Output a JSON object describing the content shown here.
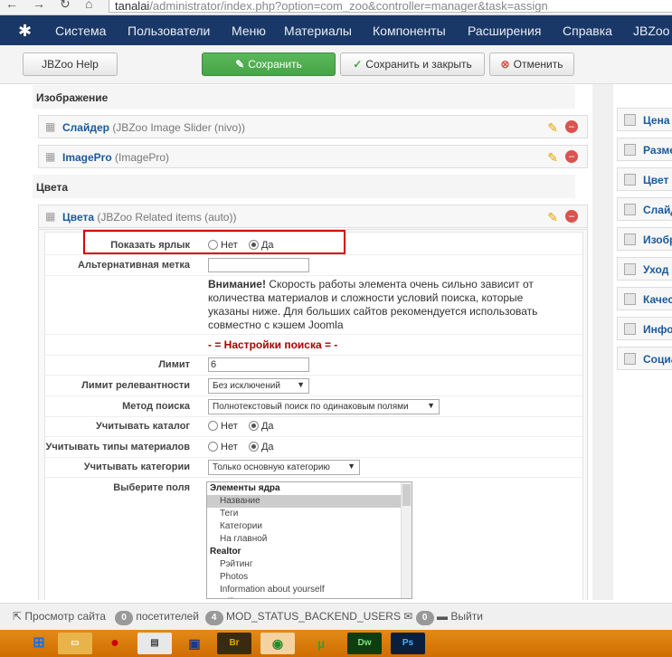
{
  "browser": {
    "url_host": "tanalai",
    "url_path": "/administrator/index.php?option=com_zoo&controller=manager&task=assign"
  },
  "menu": {
    "items": [
      "Система",
      "Пользователи",
      "Меню",
      "Материалы",
      "Компоненты",
      "Расширения",
      "Справка",
      "JBZoo"
    ]
  },
  "toolbar": {
    "help_label": "JBZoo Help",
    "save_label": "Сохранить",
    "save_close_label": "Сохранить и закрыть",
    "cancel_label": "Отменить"
  },
  "sections": {
    "image": "Изображение",
    "colors": "Цвета"
  },
  "elements": [
    {
      "title": "Слайдер",
      "subtitle": "(JBZoo Image Slider (nivo))"
    },
    {
      "title": "ImagePro",
      "subtitle": "(ImagePro)"
    },
    {
      "title": "Цвета",
      "subtitle": "(JBZoo Related items (auto))"
    }
  ],
  "params": {
    "show_label": "Показать ярлык",
    "no": "Нет",
    "yes": "Да",
    "alt_label": "Альтернативная метка",
    "warning_bold": "Внимание!",
    "warning_text": " Скорость работы элемента очень сильно зависит от количества материалов и сложности условий поиска, которые указаны ниже. Для больших сайтов рекомендуется использовать совместно с кэшем Joomla",
    "search_header": "- = Настройки поиска = -",
    "limit_label": "Лимит",
    "limit_value": "6",
    "relevance_label": "Лимит релевантности",
    "relevance_value": "Без исключений",
    "method_label": "Метод поиска",
    "method_value": "Полнотекстовый поиск по одинаковым полями",
    "catalog_label": "Учитывать каталог",
    "types_label": "Учитывать типы материалов",
    "categories_label": "Учитывать категории",
    "categories_value": "Только основную категорию",
    "fields_label": "Выберите поля"
  },
  "listbox": [
    {
      "kind": "grp",
      "text": "Элементы ядра"
    },
    {
      "kind": "opt sel",
      "text": "Название"
    },
    {
      "kind": "opt",
      "text": "Теги"
    },
    {
      "kind": "opt",
      "text": "Категории"
    },
    {
      "kind": "opt",
      "text": "На главной"
    },
    {
      "kind": "grp",
      "text": "Realtor"
    },
    {
      "kind": "opt",
      "text": "Рэйтинг"
    },
    {
      "kind": "opt",
      "text": "Photos"
    },
    {
      "kind": "opt",
      "text": "Information about yourself"
    },
    {
      "kind": "opt",
      "text": "Office"
    }
  ],
  "right_items": [
    "Цена",
    "Разме",
    "Цвет",
    "Слайд",
    "Изобр",
    "Уход",
    "Качес",
    "Инфо",
    "Социа"
  ],
  "status": {
    "view_site": "Просмотр сайта",
    "visitors_count": "0",
    "visitors_label": "посетителей",
    "backend_count": "4",
    "backend_label": "MOD_STATUS_BACKEND_USERS",
    "messages_count": "0",
    "logout": "Выйти"
  },
  "taskbar": {
    "br": "Br",
    "dw": "Dw",
    "ps": "Ps"
  },
  "colors": {
    "menubar": "#1a3867",
    "save_green": "#46a546",
    "highlight": "#d60000",
    "taskbar": "#e38a18"
  }
}
